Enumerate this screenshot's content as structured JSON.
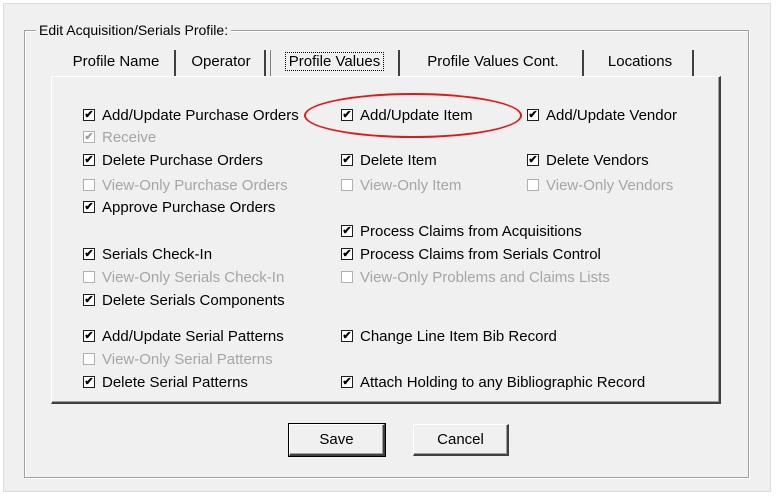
{
  "group_label": "Edit Acquisition/Serials Profile:",
  "tabs": [
    {
      "label": "Profile Name"
    },
    {
      "label": "Operator"
    },
    {
      "label": "Profile Values"
    },
    {
      "label": "Profile Values Cont."
    },
    {
      "label": "Locations"
    }
  ],
  "active_tab": "Profile Values",
  "checkboxes": [
    {
      "label": "Add/Update Purchase Orders",
      "checked": true,
      "enabled": true
    },
    {
      "label": "Receive",
      "checked": true,
      "enabled": false
    },
    {
      "label": "Delete Purchase Orders",
      "checked": true,
      "enabled": true
    },
    {
      "label": "View-Only Purchase Orders",
      "checked": false,
      "enabled": false
    },
    {
      "label": "Approve Purchase Orders",
      "checked": true,
      "enabled": true
    },
    {
      "label": "Serials Check-In",
      "checked": true,
      "enabled": true
    },
    {
      "label": "View-Only Serials Check-In",
      "checked": false,
      "enabled": false
    },
    {
      "label": "Delete Serials Components",
      "checked": true,
      "enabled": true
    },
    {
      "label": "Add/Update Serial Patterns",
      "checked": true,
      "enabled": true
    },
    {
      "label": "View-Only Serial Patterns",
      "checked": false,
      "enabled": false
    },
    {
      "label": "Delete Serial Patterns",
      "checked": true,
      "enabled": true
    },
    {
      "label": "Add/Update Item",
      "checked": true,
      "enabled": true
    },
    {
      "label": "Delete Item",
      "checked": true,
      "enabled": true
    },
    {
      "label": "View-Only Item",
      "checked": false,
      "enabled": false
    },
    {
      "label": "Process Claims from Acquisitions",
      "checked": true,
      "enabled": true
    },
    {
      "label": "Process Claims from Serials Control",
      "checked": true,
      "enabled": true
    },
    {
      "label": "View-Only Problems and Claims Lists",
      "checked": false,
      "enabled": false
    },
    {
      "label": "Change Line Item Bib Record",
      "checked": true,
      "enabled": true
    },
    {
      "label": "Attach Holding to any Bibliographic Record",
      "checked": true,
      "enabled": true
    },
    {
      "label": "Add/Update Vendor",
      "checked": true,
      "enabled": true
    },
    {
      "label": "Delete Vendors",
      "checked": true,
      "enabled": true
    },
    {
      "label": "View-Only Vendors",
      "checked": false,
      "enabled": false
    }
  ],
  "buttons": {
    "save": "Save",
    "cancel": "Cancel"
  },
  "colors": {
    "annotation_ellipse": "#e01818",
    "dialog_bg": "#f0f0f0"
  }
}
